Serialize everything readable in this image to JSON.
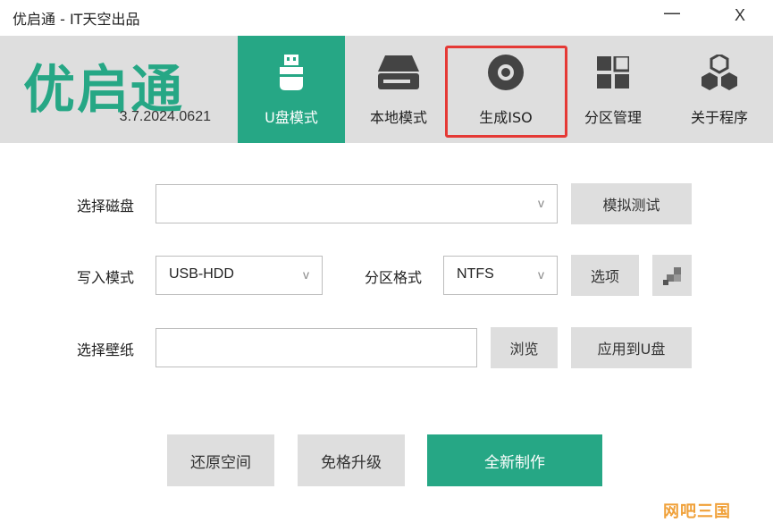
{
  "window": {
    "title": "优启通 - IT天空出品",
    "minimize_glyph": "—",
    "close_glyph": "X"
  },
  "header": {
    "logo_text": "优启通",
    "version": "3.7.2024.0621",
    "tabs": [
      {
        "label": "U盘模式",
        "icon": "usb-drive-icon",
        "active": true
      },
      {
        "label": "本地模式",
        "icon": "hard-drive-icon",
        "active": false
      },
      {
        "label": "生成ISO",
        "icon": "disc-icon",
        "active": false,
        "highlighted": true
      },
      {
        "label": "分区管理",
        "icon": "partition-grid-icon",
        "active": false
      },
      {
        "label": "关于程序",
        "icon": "about-cubes-icon",
        "active": false
      }
    ]
  },
  "form": {
    "disk": {
      "label": "选择磁盘",
      "value": "",
      "test_button": "模拟测试"
    },
    "write_mode": {
      "label": "写入模式",
      "value": "USB-HDD"
    },
    "partition_format": {
      "label": "分区格式",
      "value": "NTFS",
      "options_button": "选项"
    },
    "wallpaper": {
      "label": "选择壁纸",
      "value": "",
      "browse_button": "浏览",
      "apply_button": "应用到U盘"
    }
  },
  "actions": {
    "restore": "还原空间",
    "upgrade": "免格升级",
    "create": "全新制作"
  },
  "watermark": "网吧三国",
  "colors": {
    "accent": "#26a785",
    "header_bg": "#dedede",
    "highlight": "#e53935",
    "watermark": "#f0a13a"
  }
}
